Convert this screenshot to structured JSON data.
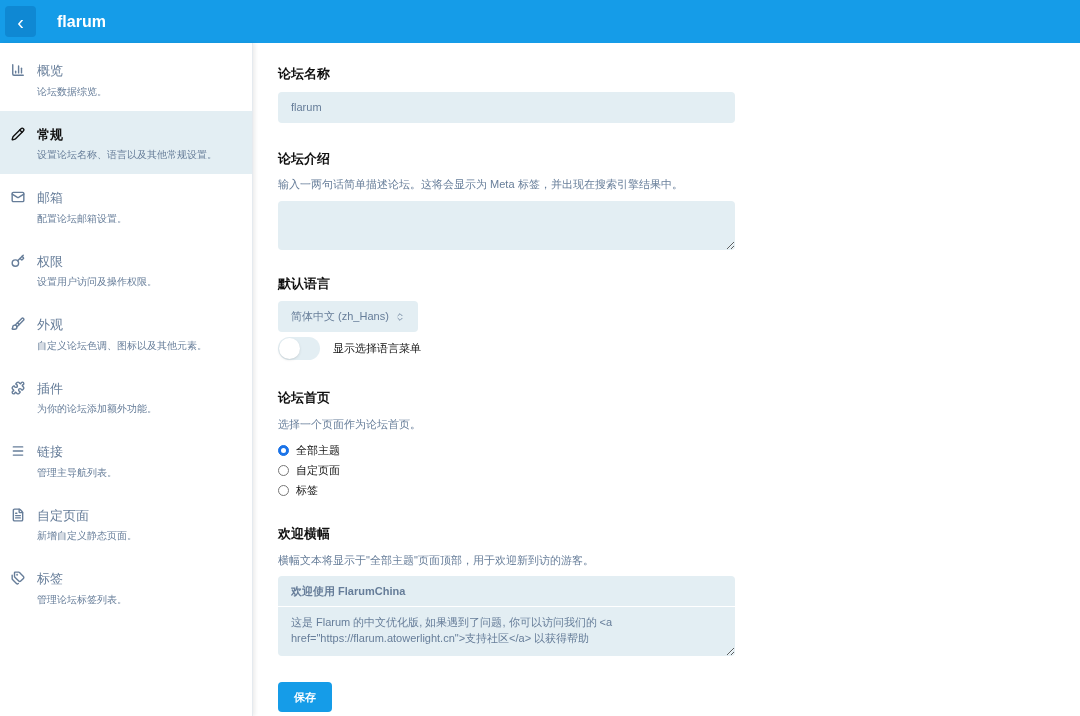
{
  "header": {
    "back": "‹",
    "title": "flarum"
  },
  "sidebar": {
    "items": [
      {
        "title": "概览",
        "description": "论坛数据综览。",
        "selected": false
      },
      {
        "title": "常规",
        "description": "设置论坛名称、语言以及其他常规设置。",
        "selected": true
      },
      {
        "title": "邮箱",
        "description": "配置论坛邮箱设置。",
        "selected": false
      },
      {
        "title": "权限",
        "description": "设置用户访问及操作权限。",
        "selected": false
      },
      {
        "title": "外观",
        "description": "自定义论坛色调、图标以及其他元素。",
        "selected": false
      },
      {
        "title": "插件",
        "description": "为你的论坛添加额外功能。",
        "selected": false
      },
      {
        "title": "链接",
        "description": "管理主导航列表。",
        "selected": false
      },
      {
        "title": "自定页面",
        "description": "新增自定义静态页面。",
        "selected": false
      },
      {
        "title": "标签",
        "description": "管理论坛标签列表。",
        "selected": false
      }
    ]
  },
  "forum_name": {
    "label": "论坛名称",
    "value": "flarum"
  },
  "forum_description": {
    "label": "论坛介绍",
    "help": "输入一两句话简单描述论坛。这将会显示为 Meta 标签，并出现在搜索引擎结果中。"
  },
  "default_language": {
    "label": "默认语言",
    "value": "简体中文 (zh_Hans)",
    "toggle": {
      "label": "显示选择语言菜单",
      "on": false
    }
  },
  "home_page": {
    "label": "论坛首页",
    "help": "选择一个页面作为论坛首页。",
    "options": [
      {
        "label": "全部主题",
        "selected": true
      },
      {
        "label": "自定页面",
        "selected": false
      },
      {
        "label": "标签",
        "selected": false
      }
    ]
  },
  "welcome_banner": {
    "label": "欢迎横幅",
    "help": "横幅文本将显示于\"全部主题\"页面顶部，用于欢迎新到访的游客。",
    "title": "欢迎使用 FlarumChina",
    "body": "这是 Flarum 的中文优化版, 如果遇到了问题, 你可以访问我们的 <a href=\"https://flarum.atowerlight.cn\">支持社区</a> 以获得帮助"
  },
  "save_button": "保存"
}
